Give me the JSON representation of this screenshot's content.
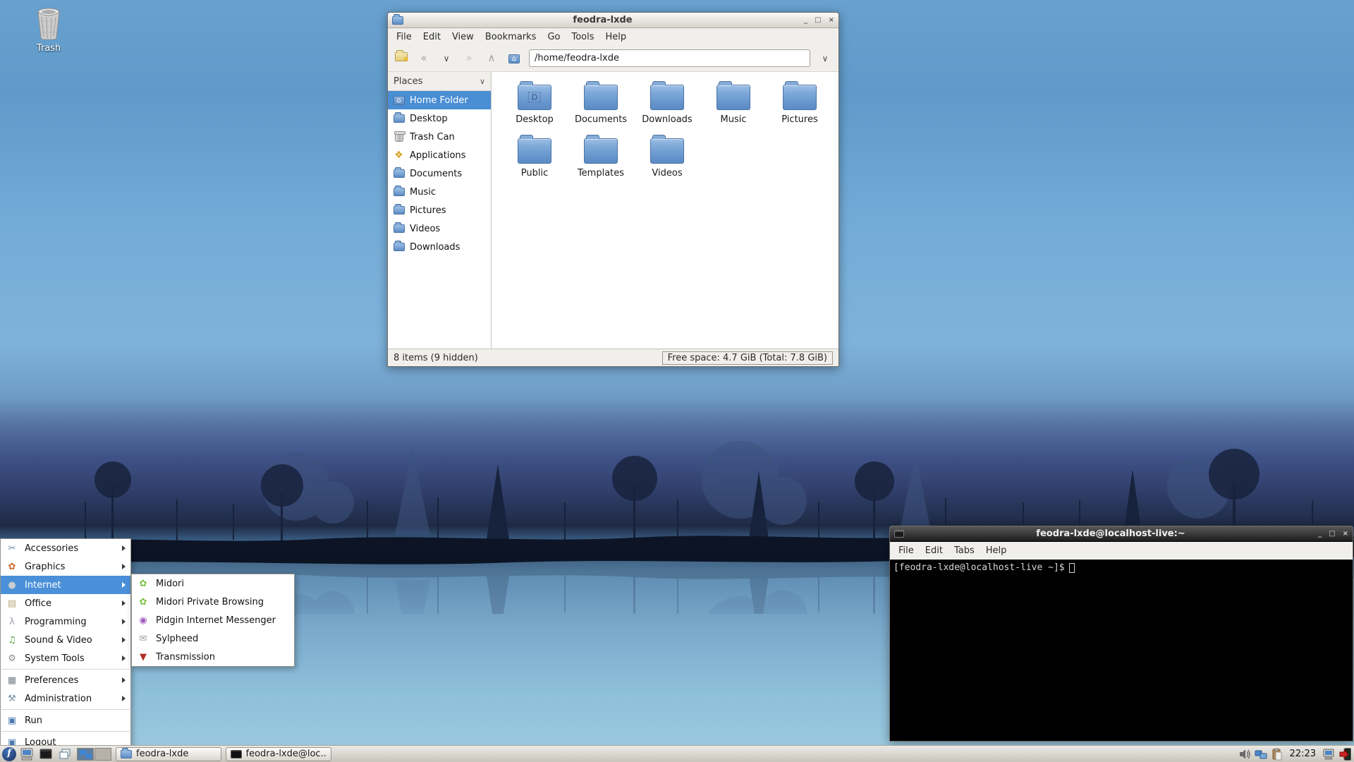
{
  "desktop": {
    "trash_label": "Trash"
  },
  "colors": {
    "accent_blue": "#4a90d8",
    "folder_blue": "#6594cc",
    "terminal_bg": "#000000",
    "panel_gray": "#c9c5bd",
    "wallpaper_sky": "#74acd8",
    "wallpaper_trees": "#17223c"
  },
  "icons": {
    "chevron_down": "∨",
    "back": "«",
    "forward": "»",
    "up": "∧",
    "home": "⌂",
    "applications": "❖"
  },
  "file_manager": {
    "title": "feodra-lxde",
    "controls": {
      "min": "_",
      "max": "□",
      "close": "×"
    },
    "menu": [
      "File",
      "Edit",
      "View",
      "Bookmarks",
      "Go",
      "Tools",
      "Help"
    ],
    "toolbar": {
      "path_value": "/home/feodra-lxde"
    },
    "places_header": "Places",
    "places": [
      {
        "label": "Home Folder",
        "selected": true
      },
      {
        "label": "Desktop"
      },
      {
        "label": "Trash Can"
      },
      {
        "label": "Applications"
      },
      {
        "label": "Documents"
      },
      {
        "label": "Music"
      },
      {
        "label": "Pictures"
      },
      {
        "label": "Videos"
      },
      {
        "label": "Downloads"
      }
    ],
    "folders": [
      "Desktop",
      "Documents",
      "Downloads",
      "Music",
      "Pictures",
      "Public",
      "Templates",
      "Videos"
    ],
    "status": {
      "left": "8 items (9 hidden)",
      "right": "Free space: 4.7 GiB (Total: 7.8 GiB)"
    }
  },
  "terminal": {
    "title": "feodra-lxde@localhost-live:~",
    "controls": {
      "min": "_",
      "max": "□",
      "close": "×"
    },
    "menu": [
      "File",
      "Edit",
      "Tabs",
      "Help"
    ],
    "prompt": "[feodra-lxde@localhost-live ~]$"
  },
  "app_menu": {
    "items": [
      {
        "label": "Accessories",
        "icon": "✂"
      },
      {
        "label": "Graphics",
        "icon": "✿"
      },
      {
        "label": "Internet",
        "icon": "●",
        "highlighted": true
      },
      {
        "label": "Office",
        "icon": "▤"
      },
      {
        "label": "Programming",
        "icon": "λ"
      },
      {
        "label": "Sound & Video",
        "icon": "♫"
      },
      {
        "label": "System Tools",
        "icon": "⚙"
      },
      {
        "label": "Preferences",
        "icon": "▦"
      },
      {
        "label": "Administration",
        "icon": "⚒"
      },
      {
        "label": "Run",
        "icon": "▣"
      },
      {
        "label": "Logout",
        "icon": "▣"
      }
    ],
    "submenu": [
      {
        "label": "Midori",
        "icon": "✿"
      },
      {
        "label": "Midori Private Browsing",
        "icon": "✿"
      },
      {
        "label": "Pidgin Internet Messenger",
        "icon": "◉"
      },
      {
        "label": "Sylpheed",
        "icon": "✉"
      },
      {
        "label": "Transmission",
        "icon": "▼"
      }
    ]
  },
  "taskbar": {
    "tasks": [
      {
        "label": "feodra-lxde"
      },
      {
        "label": "feodra-lxde@loc..."
      }
    ],
    "clock": "22:23"
  }
}
